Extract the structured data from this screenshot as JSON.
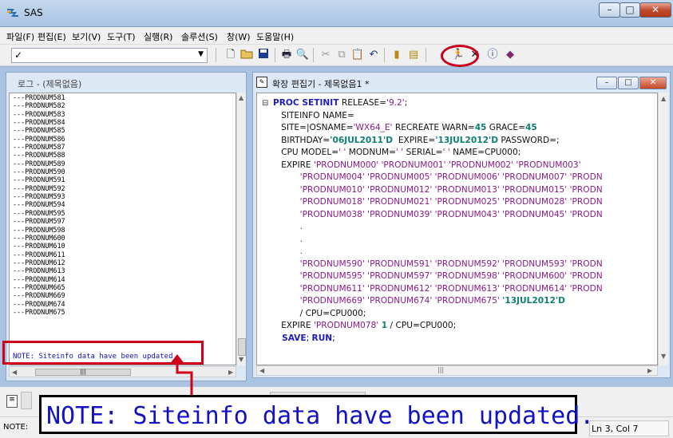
{
  "window": {
    "title": "SAS"
  },
  "menu": [
    "파일(F)",
    "편집(E)",
    "보기(V)",
    "도구(T)",
    "실행(R)",
    "솔루션(S)",
    "창(W)",
    "도움말(H)"
  ],
  "toolbar": {
    "command_check": "✓",
    "icons": [
      "new-icon",
      "open-icon",
      "save-icon",
      "print-icon",
      "print-preview-icon",
      "cut-icon",
      "copy-icon",
      "paste-icon",
      "undo-icon",
      "library-icon",
      "explorer-icon",
      "submit-run-icon",
      "clear-icon",
      "help-icon",
      "bookmark-icon"
    ]
  },
  "log": {
    "title": "로그 - (제목없음)",
    "lines": [
      "---PRODNUM581",
      "---PRODNUM582",
      "---PRODNUM583",
      "---PRODNUM584",
      "---PRODNUM585",
      "---PRODNUM586",
      "---PRODNUM587",
      "---PRODNUM588",
      "---PRODNUM589",
      "---PRODNUM590",
      "---PRODNUM591",
      "---PRODNUM592",
      "---PRODNUM593",
      "---PRODNUM594",
      "---PRODNUM595",
      "---PRODNUM597",
      "---PRODNUM598",
      "---PRODNUM600",
      "---PRODNUM610",
      "---PRODNUM611",
      "---PRODNUM612",
      "---PRODNUM613",
      "---PRODNUM614",
      "---PRODNUM665",
      "---PRODNUM669",
      "---PRODNUM674",
      "---PRODNUM675"
    ],
    "note": "NOTE: Siteinfo data have been updated."
  },
  "editor": {
    "title": "확장 편집기 - 제목없음1 *",
    "lines": [
      [
        {
          "t": "PROC SETINIT",
          "c": "k"
        },
        {
          "t": " RELEASE=",
          "c": ""
        },
        {
          "t": "'9.2'",
          "c": "s"
        },
        {
          "t": ";",
          "c": ""
        }
      ],
      [
        {
          "t": "   SITEINFO NAME=",
          "c": ""
        }
      ],
      [
        {
          "t": "   SITE=|OSNAME=",
          "c": ""
        },
        {
          "t": "'WX64_E'",
          "c": "s"
        },
        {
          "t": " RECREATE WARN=",
          "c": ""
        },
        {
          "t": "45",
          "c": "n"
        },
        {
          "t": " GRACE=",
          "c": ""
        },
        {
          "t": "45",
          "c": "n"
        }
      ],
      [
        {
          "t": "   BIRTHDAY=",
          "c": ""
        },
        {
          "t": "'06JUL2011'D",
          "c": "d"
        },
        {
          "t": "  EXPIRE=",
          "c": ""
        },
        {
          "t": "'13JUL2012'D",
          "c": "d"
        },
        {
          "t": " PASSWORD=;",
          "c": ""
        }
      ],
      [
        {
          "t": "   CPU MODEL=",
          "c": ""
        },
        {
          "t": "' '",
          "c": "s"
        },
        {
          "t": " MODNUM=",
          "c": ""
        },
        {
          "t": "' '",
          "c": "s"
        },
        {
          "t": " SERIAL=",
          "c": ""
        },
        {
          "t": "' '",
          "c": "s"
        },
        {
          "t": " NAME=CPU000;",
          "c": ""
        }
      ],
      [
        {
          "t": "   EXPIRE ",
          "c": ""
        },
        {
          "t": "'PRODNUM000' 'PRODNUM001' 'PRODNUM002' 'PRODNUM003'",
          "c": "s"
        }
      ],
      [
        {
          "t": "          'PRODNUM004' 'PRODNUM005' 'PRODNUM006' 'PRODNUM007' 'PRODN",
          "c": "s"
        }
      ],
      [
        {
          "t": "          'PRODNUM010' 'PRODNUM012' 'PRODNUM013' 'PRODNUM015' 'PRODN",
          "c": "s"
        }
      ],
      [
        {
          "t": "          'PRODNUM018' 'PRODNUM021' 'PRODNUM025' 'PRODNUM028' 'PRODN",
          "c": "s"
        }
      ],
      [
        {
          "t": "          'PRODNUM038' 'PRODNUM039' 'PRODNUM043' 'PRODNUM045' 'PRODN",
          "c": "s"
        }
      ],
      [
        {
          "t": "          .",
          "c": "s"
        }
      ],
      [
        {
          "t": "          .",
          "c": "s"
        }
      ],
      [
        {
          "t": "          .",
          "c": "s"
        }
      ],
      [
        {
          "t": "          'PRODNUM590' 'PRODNUM591' 'PRODNUM592' 'PRODNUM593' 'PRODN",
          "c": "s"
        }
      ],
      [
        {
          "t": "          'PRODNUM595' 'PRODNUM597' 'PRODNUM598' 'PRODNUM600' 'PRODN",
          "c": "s"
        }
      ],
      [
        {
          "t": "          'PRODNUM611' 'PRODNUM612' 'PRODNUM613' 'PRODNUM614' 'PRODN",
          "c": "s"
        }
      ],
      [
        {
          "t": "          'PRODNUM669' 'PRODNUM674' 'PRODNUM675' ",
          "c": "s"
        },
        {
          "t": "'13JUL2012'D",
          "c": "d"
        }
      ],
      [
        {
          "t": "          / CPU=CPU000;",
          "c": ""
        }
      ],
      [
        {
          "t": "   EXPIRE ",
          "c": ""
        },
        {
          "t": "'PRODNUM078'",
          "c": "s"
        },
        {
          "t": " 1",
          "c": "n"
        },
        {
          "t": " / CPU=CPU000;",
          "c": ""
        }
      ],
      [
        {
          "t": "   SAVE",
          "c": "k"
        },
        {
          "t": "; ",
          "c": ""
        },
        {
          "t": "RUN",
          "c": "k"
        },
        {
          "t": ";",
          "c": ""
        }
      ]
    ]
  },
  "status": {
    "note": "NOTE:",
    "position": "Ln 3, Col 7"
  },
  "callout": {
    "text": "NOTE: Siteinfo data have been updated."
  },
  "colors": {
    "annotation_red": "#c8001e",
    "log_note_blue": "#1010c8",
    "keyword_blue": "#1d1dbd",
    "string_purple": "#8a1a8a",
    "number_teal": "#0e7e73"
  }
}
